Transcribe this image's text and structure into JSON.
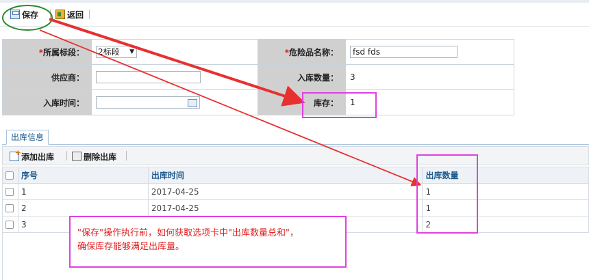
{
  "toolbar": {
    "save_label": "保存",
    "back_label": "返回"
  },
  "form": {
    "section_label": {
      "label": "所属标段：",
      "value": "2标段"
    },
    "hazard_name": {
      "label": "危险品名称：",
      "value": "fsd fds"
    },
    "supplier": {
      "label": "供应商：",
      "value": ""
    },
    "inbound_qty": {
      "label": "入库数量：",
      "value": "3"
    },
    "inbound_time": {
      "label": "入库时间：",
      "value": ""
    },
    "stock": {
      "label": "库存：",
      "value": "1"
    },
    "required_mark": "*"
  },
  "tab": {
    "label": "出库信息"
  },
  "grid_toolbar": {
    "add_label": "添加出库",
    "delete_label": "删除出库"
  },
  "grid": {
    "columns": [
      "序号",
      "出库时间",
      "出库数量"
    ],
    "rows": [
      {
        "seq": "1",
        "time": "2017-04-25",
        "qty": "1"
      },
      {
        "seq": "2",
        "time": "2017-04-25",
        "qty": "1"
      },
      {
        "seq": "3",
        "time": "",
        "qty": "2"
      }
    ]
  },
  "annotation": {
    "line1": "\"保存\"操作执行前，如何获取选项卡中\"出库数量总和\"，",
    "line2": "确保库存能够满足出库量。",
    "highlight_color": "#e040e0",
    "arrow_color": "#e83030",
    "circle_color": "#2a8a2a"
  }
}
